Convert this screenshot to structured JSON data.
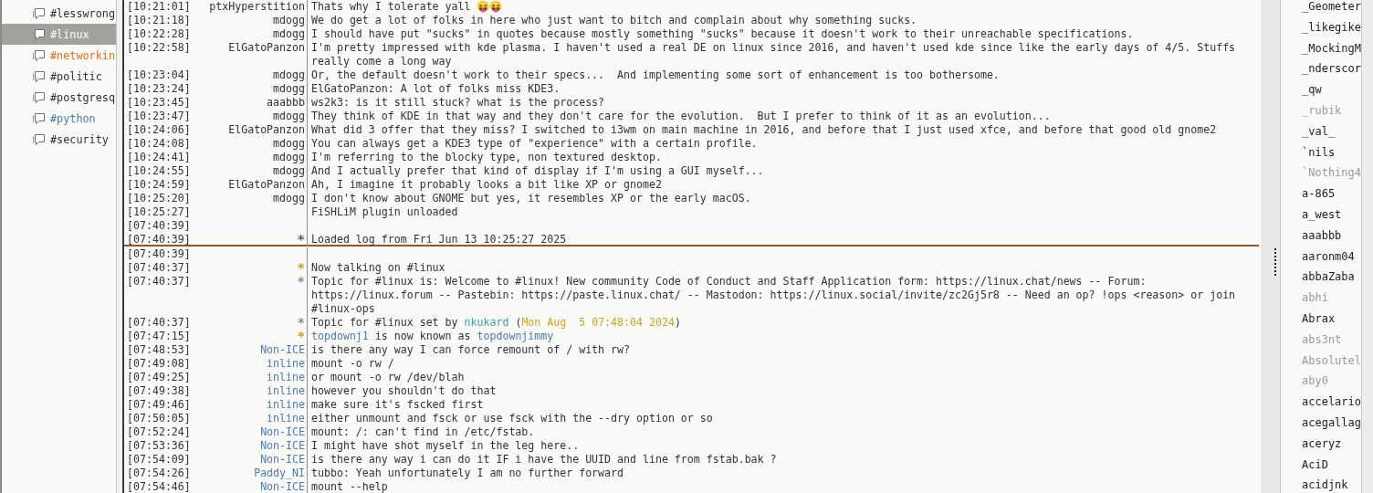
{
  "channels": [
    {
      "name": "#lesswrong",
      "selected": false,
      "color": "#2e3436"
    },
    {
      "name": "#linux",
      "selected": true
    },
    {
      "name": "#networkin",
      "selected": false,
      "color": "#e8700e"
    },
    {
      "name": "#politic",
      "selected": false,
      "color": "#2e3436"
    },
    {
      "name": "#postgresq",
      "selected": false,
      "color": "#2e3436"
    },
    {
      "name": "#python",
      "selected": false,
      "color": "#4a7ab5"
    },
    {
      "name": "#security",
      "selected": false,
      "color": "#2e3436"
    }
  ],
  "backlog": [
    {
      "time": "[10:21:01]",
      "nick": "ptxHyperstition",
      "color": "#2e3436",
      "text": "Thats why I tolerate yall 😝😝"
    },
    {
      "time": "[10:21:18]",
      "nick": "mdogg",
      "color": "#2e3436",
      "text": "We do get a lot of folks in here who just want to bitch and complain about why something sucks."
    },
    {
      "time": "[10:22:28]",
      "nick": "mdogg",
      "color": "#2e3436",
      "text": "I should have put \"sucks\" in quotes because mostly something \"sucks\" because it doesn't work to their unreachable specifications."
    },
    {
      "time": "[10:22:58]",
      "nick": "ElGatoPanzon",
      "color": "#2e3436",
      "lines": [
        "I'm pretty impressed with kde plasma. I haven't used a real DE on linux since 2016, and haven't used kde since like the early days of 4/5. Stuffs",
        "really come a long way"
      ]
    },
    {
      "time": "[10:23:04]",
      "nick": "mdogg",
      "color": "#2e3436",
      "text": "Or, the default doesn't work to their specs...  And implementing some sort of enhancement is too bothersome."
    },
    {
      "time": "[10:23:24]",
      "nick": "mdogg",
      "color": "#2e3436",
      "text": "ElGatoPanzon: A lot of folks miss KDE3."
    },
    {
      "time": "[10:23:45]",
      "nick": "aaabbb",
      "color": "#2e3436",
      "text": "ws2k3: is it still stuck? what is the process?"
    },
    {
      "time": "[10:23:47]",
      "nick": "mdogg",
      "color": "#2e3436",
      "text": "They think of KDE in that way and they don't care for the evolution.  But I prefer to think of it as an evolution..."
    },
    {
      "time": "[10:24:06]",
      "nick": "ElGatoPanzon",
      "color": "#2e3436",
      "text": "What did 3 offer that they miss? I switched to i3wm on main machine in 2016, and before that I just used xfce, and before that good old gnome2"
    },
    {
      "time": "[10:24:08]",
      "nick": "mdogg",
      "color": "#2e3436",
      "text": "You can always get a KDE3 type of \"experience\" with a certain profile."
    },
    {
      "time": "[10:24:41]",
      "nick": "mdogg",
      "color": "#2e3436",
      "text": "I'm referring to the blocky type, non textured desktop."
    },
    {
      "time": "[10:24:55]",
      "nick": "mdogg",
      "color": "#2e3436",
      "text": "And I actually prefer that kind of display if I'm using a GUI myself..."
    },
    {
      "time": "[10:24:59]",
      "nick": "ElGatoPanzon",
      "color": "#2e3436",
      "text": "Ah, I imagine it probably looks a bit like XP or gnome2"
    },
    {
      "time": "[10:25:20]",
      "nick": "mdogg",
      "color": "#2e3436",
      "text": "I don't know about GNOME but yes, it resembles XP or the early macOS."
    },
    {
      "time": "[10:25:27]",
      "text": "FiSHLiM plugin unloaded"
    },
    {
      "time": "[07:40:39]"
    },
    {
      "time": "[07:40:39]",
      "nick": "*",
      "color": "#555753",
      "text": "Loaded log from Fri Jun 13 10:25:27 2025"
    }
  ],
  "messages": [
    {
      "time": "[07:40:39]"
    },
    {
      "time": "[07:40:37]",
      "nick": "*",
      "color": "#c4a000",
      "text": "Now talking on #linux"
    },
    {
      "time": "[07:40:37]",
      "nick": "*",
      "color": "#888a85",
      "lines": [
        "Topic for #linux is: Welcome to #linux! New community Code of Conduct and Staff Application form: https://linux.chat/news -- Forum:",
        "https://linux.forum -- Pastebin: https://paste.linux.chat/ -- Mastodon: https://linux.social/invite/zc2Gj5r8 -- Need an op? !ops <reason> or join",
        "#linux-ops"
      ]
    },
    {
      "time": "[07:40:37]",
      "nick": "*",
      "color": "#888a85",
      "parts": [
        {
          "text": "Topic for #linux set by "
        },
        {
          "text": "nkukard",
          "color": "#3a9fb0"
        },
        {
          "text": " ("
        },
        {
          "text": "Mon Aug  5 07:48:04 2024",
          "color": "#d4a017"
        },
        {
          "text": ")"
        }
      ]
    },
    {
      "time": "[07:47:15]",
      "nick": "*",
      "color": "#c4a000",
      "parts": [
        {
          "text": "topdownj1",
          "color": "#4a7ab5"
        },
        {
          "text": " is now known as "
        },
        {
          "text": "topdownjimmy",
          "color": "#4a7ab5"
        }
      ]
    },
    {
      "time": "[07:48:53]",
      "nick": "Non-ICE",
      "color": "#4a7ab5",
      "text": "is there any way I can force remount of / with rw?"
    },
    {
      "time": "[07:49:08]",
      "nick": "inline",
      "color": "#4a7ab5",
      "text": "mount -o rw /"
    },
    {
      "time": "[07:49:25]",
      "nick": "inline",
      "color": "#4a7ab5",
      "text": "or mount -o rw /dev/blah"
    },
    {
      "time": "[07:49:38]",
      "nick": "inline",
      "color": "#4a7ab5",
      "text": "however you shouldn't do that"
    },
    {
      "time": "[07:49:46]",
      "nick": "inline",
      "color": "#4a7ab5",
      "text": "make sure it's fscked first"
    },
    {
      "time": "[07:50:05]",
      "nick": "inline",
      "color": "#4a7ab5",
      "text": "either unmount and fsck or use fsck with the --dry option or so"
    },
    {
      "time": "[07:52:24]",
      "nick": "Non-ICE",
      "color": "#4a7ab5",
      "text": "mount: /: can't find in /etc/fstab."
    },
    {
      "time": "[07:53:36]",
      "nick": "Non-ICE",
      "color": "#4a7ab5",
      "text": "I might have shot myself in the leg here.."
    },
    {
      "time": "[07:54:09]",
      "nick": "Non-ICE",
      "color": "#4a7ab5",
      "text": "is there any way i can do it IF i have the UUID and line from fstab.bak ?"
    },
    {
      "time": "[07:54:26]",
      "nick": "Paddy_NI",
      "color": "#4a7ab5",
      "text": "tubbo: Yeah unfortunately I am no further forward"
    },
    {
      "time": "[07:54:46]",
      "nick": "Non-ICE",
      "color": "#4a7ab5",
      "text": "mount --help"
    }
  ],
  "users": [
    {
      "name": "_Geometer",
      "away": false
    },
    {
      "name": "_likegike",
      "away": false
    },
    {
      "name": "_MockingM",
      "away": false
    },
    {
      "name": "_nderscor",
      "away": false
    },
    {
      "name": "_qw",
      "away": false
    },
    {
      "name": "_rubik",
      "away": true
    },
    {
      "name": "_val_",
      "away": false
    },
    {
      "name": "`nils",
      "away": false
    },
    {
      "name": "`Nothing4",
      "away": true
    },
    {
      "name": "a-865",
      "away": false
    },
    {
      "name": "a_west",
      "away": false
    },
    {
      "name": "aaabbb",
      "away": false
    },
    {
      "name": "aaronm04",
      "away": false
    },
    {
      "name": "abbaZaba",
      "away": false
    },
    {
      "name": "abhi",
      "away": true
    },
    {
      "name": "Abrax",
      "away": false
    },
    {
      "name": "abs3nt",
      "away": true
    },
    {
      "name": "Absolutel",
      "away": true
    },
    {
      "name": "aby0",
      "away": true
    },
    {
      "name": "accelario",
      "away": false
    },
    {
      "name": "acegallag",
      "away": false
    },
    {
      "name": "aceryz",
      "away": false
    },
    {
      "name": "AciD",
      "away": false
    },
    {
      "name": "acidjnk",
      "away": false
    }
  ]
}
